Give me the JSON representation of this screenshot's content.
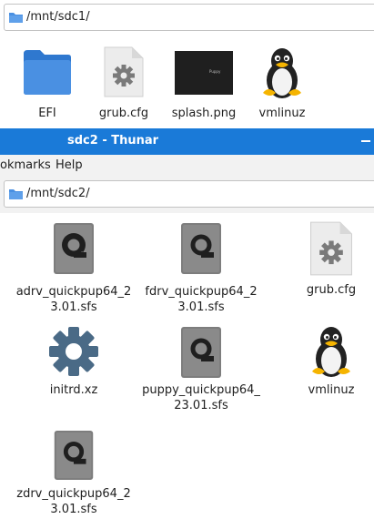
{
  "window1": {
    "path": "/mnt/sdc1/",
    "files": [
      {
        "name": "EFI",
        "icon": "folder-icon"
      },
      {
        "name": "grub.cfg",
        "icon": "config-file-icon"
      },
      {
        "name": "splash.png",
        "icon": "image-thumbnail"
      },
      {
        "name": "vmlinuz",
        "icon": "tux-icon"
      }
    ],
    "splash_thumb_text": "Puppy"
  },
  "window2": {
    "title": "sdc2 - Thunar",
    "menu": [
      "okmarks",
      "Help"
    ],
    "path": "/mnt/sdc2/",
    "files": [
      {
        "name_l1": "adrv_quickpup64_2",
        "name_l2": "3.01.sfs",
        "icon": "disk-image-icon"
      },
      {
        "name_l1": "fdrv_quickpup64_2",
        "name_l2": "3.01.sfs",
        "icon": "disk-image-icon"
      },
      {
        "name_l1": "grub.cfg",
        "name_l2": "",
        "icon": "config-file-icon"
      },
      {
        "name_l1": "initrd.xz",
        "name_l2": "",
        "icon": "gear-icon"
      },
      {
        "name_l1": "puppy_quickpup64_",
        "name_l2": "23.01.sfs",
        "icon": "disk-image-icon"
      },
      {
        "name_l1": "vmlinuz",
        "name_l2": "",
        "icon": "tux-icon"
      },
      {
        "name_l1": "zdrv_quickpup64_2",
        "name_l2": "3.01.sfs",
        "icon": "disk-image-icon"
      }
    ]
  },
  "colors": {
    "titlebar": "#1a7ad8",
    "folder": "#4a90e2",
    "disk": "#7d7d7d"
  }
}
